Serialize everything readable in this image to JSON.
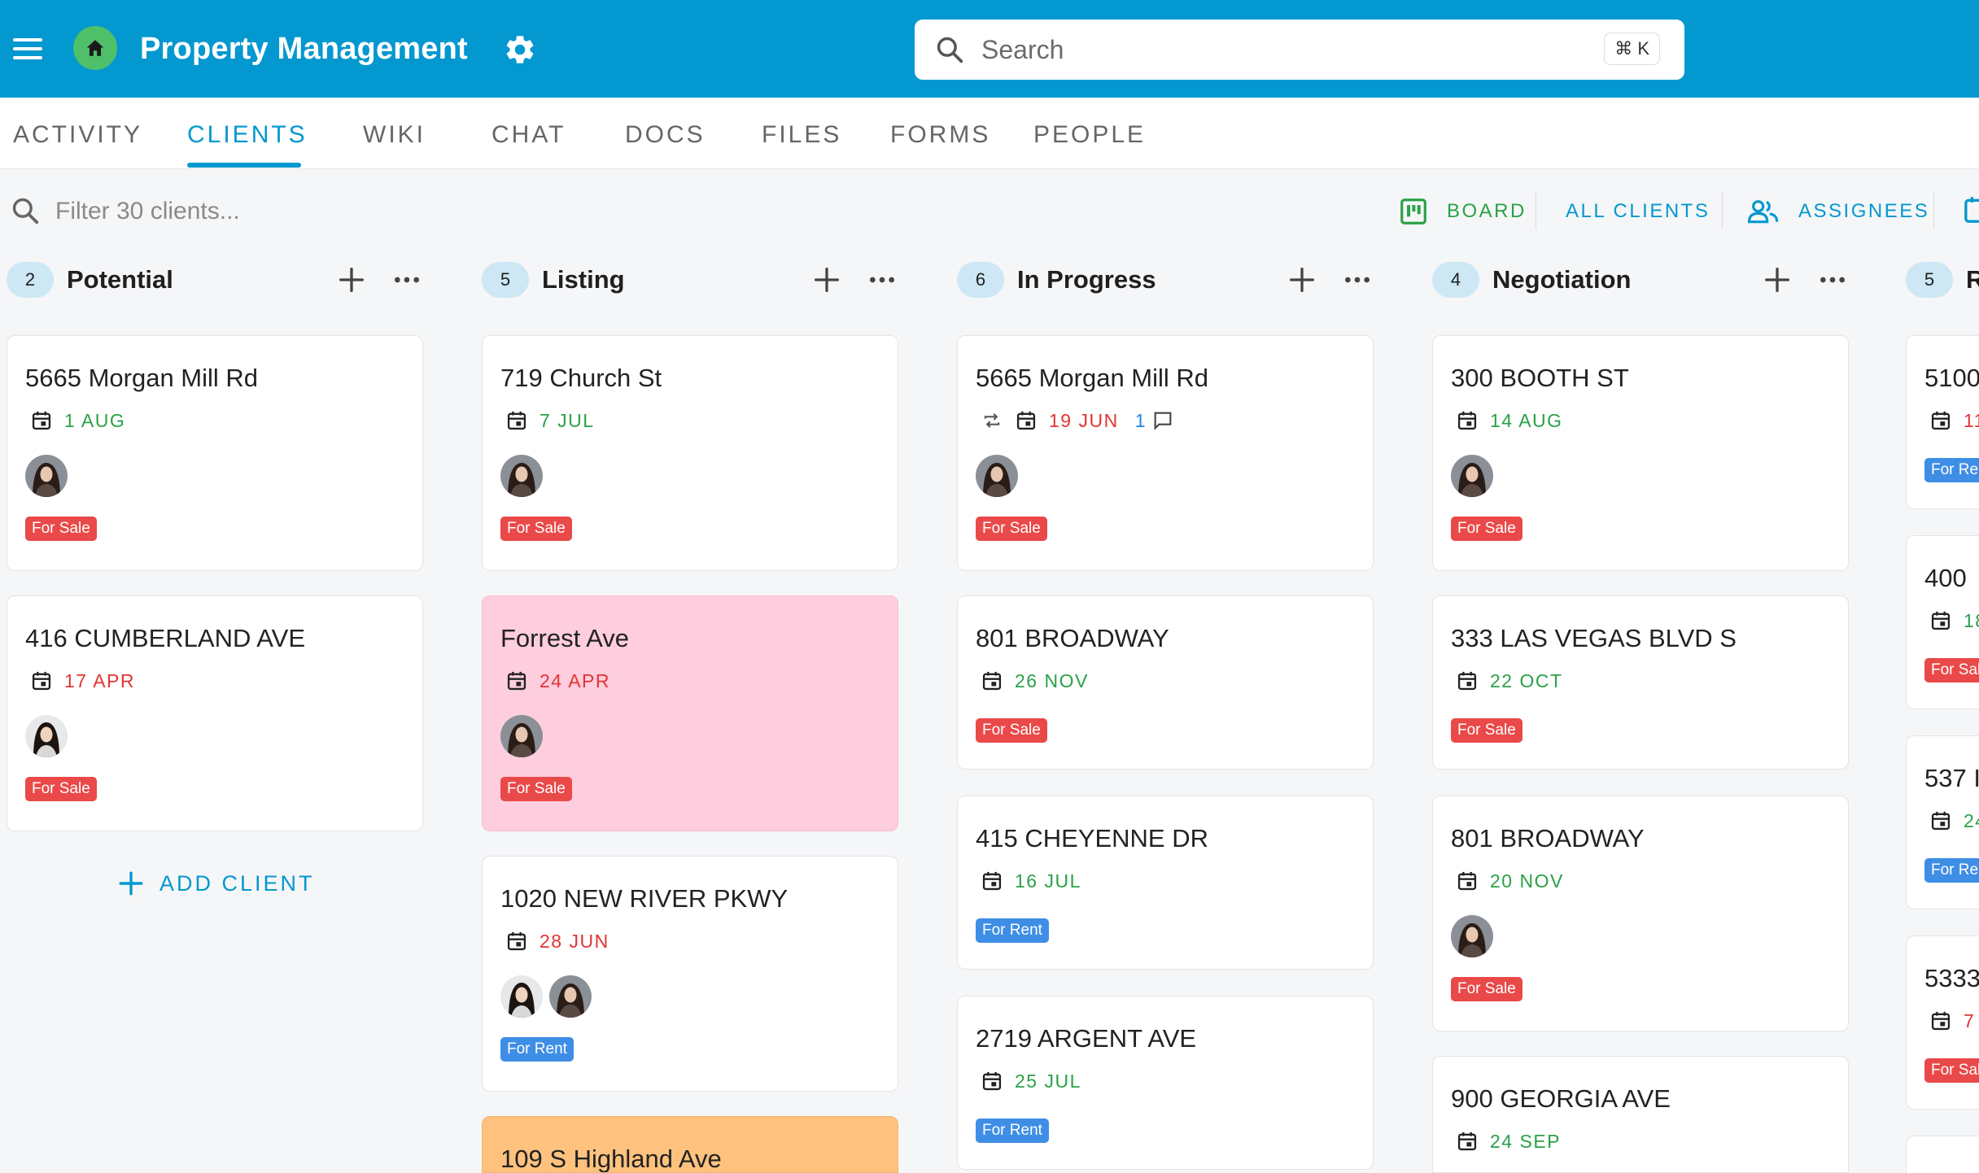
{
  "app": {
    "title": "Property Management",
    "search_placeholder": "Search",
    "search_shortcut": "⌘ K",
    "brand_color": "#0398cf"
  },
  "tabs": [
    {
      "label": "ACTIVITY"
    },
    {
      "label": "CLIENTS",
      "active": true
    },
    {
      "label": "WIKI"
    },
    {
      "label": "CHAT"
    },
    {
      "label": "DOCS"
    },
    {
      "label": "FILES"
    },
    {
      "label": "FORMS"
    },
    {
      "label": "PEOPLE"
    }
  ],
  "toolbar": {
    "filter_placeholder": "Filter 30 clients...",
    "board_label": "BOARD",
    "all_clients_label": "ALL CLIENTS",
    "assignees_label": "ASSIGNEES"
  },
  "columns": [
    {
      "count": "2",
      "title": "Potential",
      "add_client_label": "ADD CLIENT",
      "cards": [
        {
          "title": "5665 Morgan Mill Rd",
          "date": "1 AUG",
          "tag": "For Sale"
        },
        {
          "title": "416 CUMBERLAND AVE",
          "date": "17 APR",
          "tag": "For Sale"
        }
      ]
    },
    {
      "count": "5",
      "title": "Listing",
      "cards": [
        {
          "title": "719 Church St",
          "date": "7 JUL",
          "tag": "For Sale"
        },
        {
          "title": "Forrest Ave",
          "date": "24 APR",
          "tag": "For Sale"
        },
        {
          "title": "1020 NEW RIVER PKWY",
          "date": "28 JUN",
          "tag": "For Rent"
        },
        {
          "title": "109 S Highland Ave"
        }
      ]
    },
    {
      "count": "6",
      "title": "In Progress",
      "cards": [
        {
          "title": "5665 Morgan Mill Rd",
          "date": "19 JUN",
          "comments": "1",
          "tag": "For Sale"
        },
        {
          "title": "801 BROADWAY",
          "date": "26 NOV",
          "tag": "For Sale"
        },
        {
          "title": "415 CHEYENNE DR",
          "date": "16 JUL",
          "tag": "For Rent"
        },
        {
          "title": "2719 ARGENT AVE",
          "date": "25 JUL",
          "tag": "For Rent"
        }
      ]
    },
    {
      "count": "4",
      "title": "Negotiation",
      "cards": [
        {
          "title": "300 BOOTH ST",
          "date": "14 AUG",
          "tag": "For Sale"
        },
        {
          "title": "333 LAS VEGAS BLVD S",
          "date": "22 OCT",
          "tag": "For Sale"
        },
        {
          "title": "801 BROADWAY",
          "date": "20 NOV",
          "tag": "For Sale"
        },
        {
          "title": "900 GEORGIA AVE",
          "date": "24 SEP"
        }
      ]
    },
    {
      "count": "5",
      "title": "R",
      "cards": [
        {
          "title": "5100",
          "date": "11",
          "tag": "For Ren"
        },
        {
          "title": "400 ",
          "date": "18",
          "tag": "For Sal"
        },
        {
          "title": "537 I",
          "date": "24",
          "tag": "For Ren"
        },
        {
          "title": "5333",
          "date": "7",
          "tag": "For Sal"
        },
        {
          "title": ""
        }
      ]
    }
  ]
}
